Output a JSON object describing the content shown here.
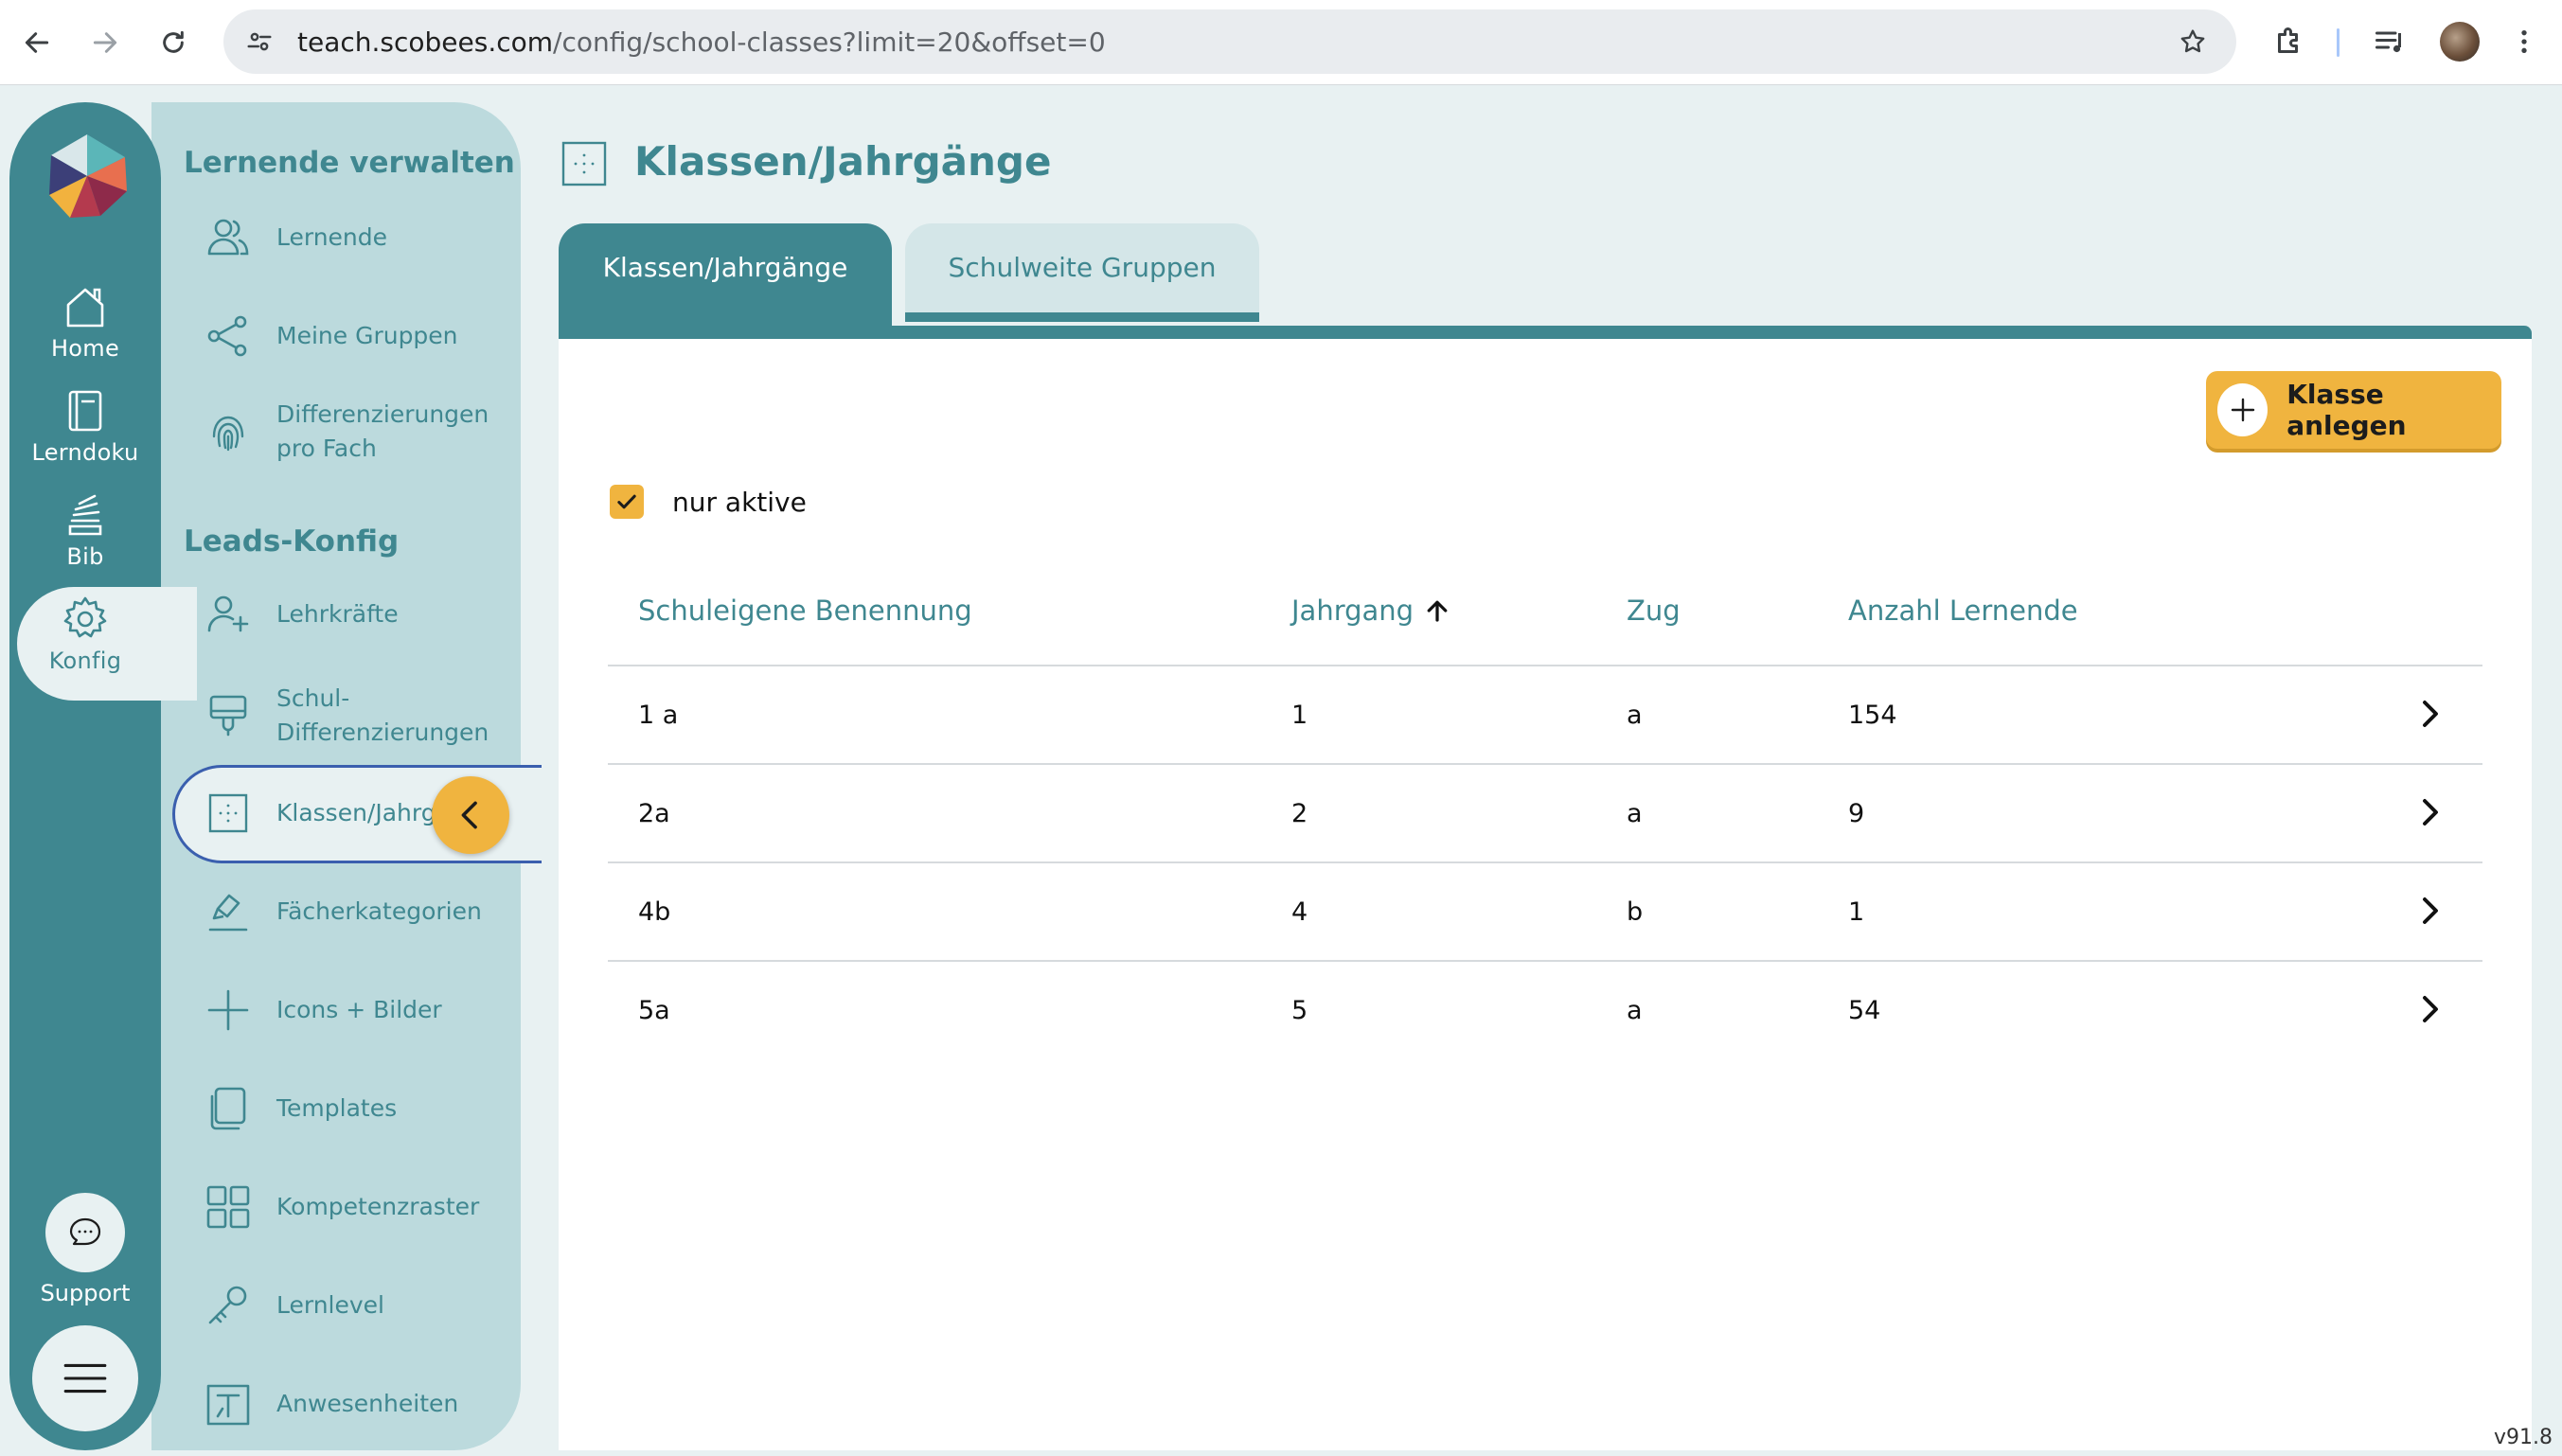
{
  "browser": {
    "url_host": "teach.scobees.com",
    "url_path": "/config/school-classes?limit=20&offset=0"
  },
  "rail": {
    "items": [
      {
        "label": "Home",
        "icon": "home-icon"
      },
      {
        "label": "Lerndoku",
        "icon": "book-icon"
      },
      {
        "label": "Bib",
        "icon": "library-icon"
      },
      {
        "label": "Konfig",
        "icon": "gear-icon",
        "active": true
      }
    ],
    "support_label": "Support"
  },
  "sidebar": {
    "section1_title": "Lernende verwalten",
    "section2_title": "Leads-Konfig",
    "items": [
      {
        "label": "Lernende",
        "icon": "users-icon"
      },
      {
        "label": "Meine Gruppen",
        "icon": "share-nodes-icon"
      },
      {
        "label": "Differenzierungen pro Fach",
        "icon": "fingerprint-icon"
      },
      {
        "label": "Lehrkräfte",
        "icon": "user-plus-icon"
      },
      {
        "label": "Schul-Differenzierungen",
        "icon": "paint-brush-icon"
      },
      {
        "label": "Klassen/Jahrgä",
        "icon": "grid-dots-icon",
        "active": true
      },
      {
        "label": "Fächerkategorien",
        "icon": "tag-pen-icon"
      },
      {
        "label": "Icons + Bilder",
        "icon": "plus-icon"
      },
      {
        "label": "Templates",
        "icon": "copy-icon"
      },
      {
        "label": "Kompetenzraster",
        "icon": "grid-icon"
      },
      {
        "label": "Lernlevel",
        "icon": "key-icon"
      },
      {
        "label": "Anwesenheiten",
        "icon": "attendance-icon"
      }
    ]
  },
  "main": {
    "title": "Klassen/Jahrgänge",
    "tabs": [
      {
        "label": "Klassen/Jahrgänge",
        "active": true
      },
      {
        "label": "Schulweite Gruppen",
        "active": false
      }
    ],
    "add_button_label": "Klasse anlegen",
    "filter_label": "nur aktive",
    "filter_checked": true,
    "table": {
      "columns": [
        "Schuleigene Benennung",
        "Jahrgang",
        "Zug",
        "Anzahl Lernende"
      ],
      "sort_column": "Jahrgang",
      "sort_direction": "ascending",
      "rows": [
        {
          "name": "1 a",
          "jahrgang": "1",
          "zug": "a",
          "anzahl": "154"
        },
        {
          "name": "2a",
          "jahrgang": "2",
          "zug": "a",
          "anzahl": "9"
        },
        {
          "name": "4b",
          "jahrgang": "4",
          "zug": "b",
          "anzahl": "1"
        },
        {
          "name": "5a",
          "jahrgang": "5",
          "zug": "a",
          "anzahl": "54"
        }
      ]
    }
  },
  "version": "v91.8",
  "colors": {
    "teal": "#3f8790",
    "accent": "#f0b43f",
    "sidebar_bg": "#bcdadd",
    "page_bg": "#e8f1f2"
  }
}
